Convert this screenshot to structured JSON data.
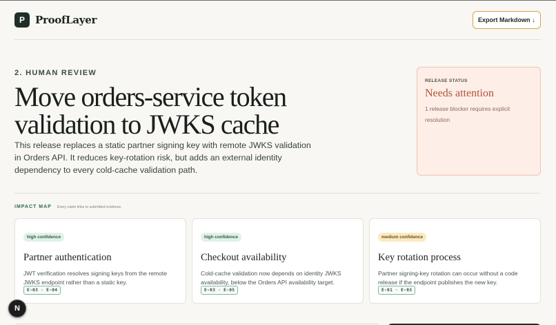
{
  "app": {
    "logo_letter": "P",
    "name": "ProofLayer"
  },
  "header": {
    "export_label": "Export Markdown",
    "export_icon": "↓"
  },
  "section": {
    "label": "2. HUMAN REVIEW"
  },
  "title": "Move orders-service token validation to JWKS cache",
  "description": "This release replaces a static partner signing key with remote JWKS validation in Orders API. It reduces key-rotation risk, but adds an external identity dependency to every cold-cache validation path.",
  "release_status": {
    "label": "RELEASE STATUS",
    "value": "Needs attention",
    "note": "1 release blocker requires explicit resolution"
  },
  "impact_map": {
    "label": "IMPACT MAP",
    "note": "Every claim links to submitted evidence."
  },
  "cards": [
    {
      "confidence": "high confidence",
      "level": "high",
      "title": "Partner authentication",
      "body": "JWT verification resolves signing keys from the remote JWKS endpoint rather than a static key.",
      "evidence": "E-03 · E-04"
    },
    {
      "confidence": "high confidence",
      "level": "high",
      "title": "Checkout availability",
      "body": "Cold-cache validation now depends on identity JWKS availability, below the Orders API availability target.",
      "evidence": "E-03 · E-05"
    },
    {
      "confidence": "medium confidence",
      "level": "medium",
      "title": "Key rotation process",
      "body": "Partner signing-key rotation can occur without a code release if the endpoint publishes the new key.",
      "evidence": "E-01 · E-03"
    }
  ],
  "fab": {
    "letter": "N"
  },
  "colors": {
    "accent": "#2f6b4f",
    "status": "#b0523a",
    "export_border": "#d4a54a"
  }
}
